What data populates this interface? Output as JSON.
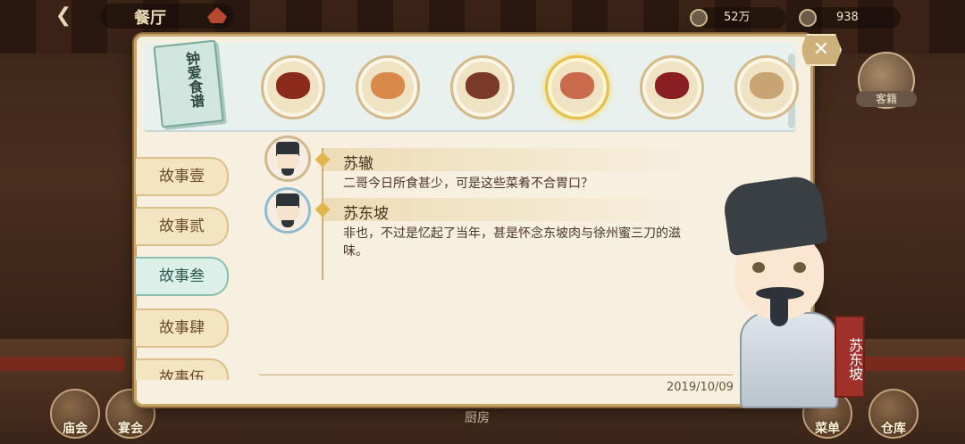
{
  "topbar": {
    "hall_title": "餐厅",
    "currency_coins": "52万",
    "currency_gems": "938"
  },
  "side": {
    "guest_label": "客籍"
  },
  "bottom_nav": {
    "items": [
      "庙会",
      "宴会",
      "菜单",
      "仓库"
    ],
    "kitchen_label": "厨房"
  },
  "recipe_book": {
    "title": "钟爱食谱"
  },
  "dishes": [
    {
      "food_color": "#8a2a1a",
      "selected": false
    },
    {
      "food_color": "#d98a4a",
      "selected": false
    },
    {
      "food_color": "#7a3a2a",
      "selected": false
    },
    {
      "food_color": "#c96a4a",
      "selected": true
    },
    {
      "food_color": "#8a1e22",
      "selected": false
    },
    {
      "food_color": "#c8a474",
      "selected": false
    }
  ],
  "story_tabs": [
    "故事壹",
    "故事贰",
    "故事叁",
    "故事肆",
    "故事伍"
  ],
  "active_tab": 2,
  "dialogue": [
    {
      "speaker": "苏辙",
      "text": "二哥今日所食甚少，可是这些菜肴不合胃口？"
    },
    {
      "speaker": "苏东坡",
      "text": "非也，不过是忆起了当年，甚是怀念东坡肉与徐州蜜三刀的滋味。"
    }
  ],
  "date": "2019/10/09",
  "character_name": "苏东坡",
  "colors": {
    "panel_bg": "#f7f0e0",
    "active_tab": "#dcefe8",
    "name_plate": "#a0312a"
  }
}
